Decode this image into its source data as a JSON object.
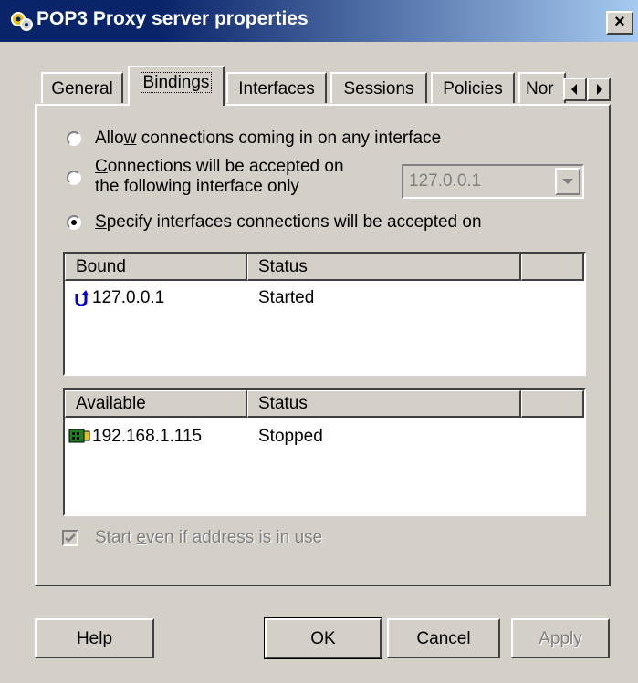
{
  "window": {
    "title": "POP3 Proxy server properties",
    "close_label": "×"
  },
  "tabs": [
    {
      "label": "General",
      "active": false
    },
    {
      "label": "Bindings",
      "active": true
    },
    {
      "label": "Interfaces",
      "active": false
    },
    {
      "label": "Sessions",
      "active": false
    },
    {
      "label": "Policies",
      "active": false
    },
    {
      "label": "Nor",
      "active": false
    }
  ],
  "radios": {
    "any_interface": {
      "pre": "Allo",
      "key": "w",
      "post": " connections coming in on any interface",
      "selected": false
    },
    "single_interface": {
      "line1_key": "C",
      "line1_post": "onnections will be accepted on",
      "line2": "the following interface only",
      "selected": false
    },
    "specify": {
      "key": "S",
      "post": "pecify interfaces connections will be accepted on",
      "selected": true
    }
  },
  "interface_select": {
    "value": "127.0.0.1"
  },
  "bound_list": {
    "headers": [
      "Bound",
      "Status"
    ],
    "rows": [
      {
        "address": "127.0.0.1",
        "status": "Started",
        "icon": "bound-arrow-icon"
      }
    ]
  },
  "available_list": {
    "headers": [
      "Available",
      "Status"
    ],
    "rows": [
      {
        "address": "192.168.1.115",
        "status": "Stopped",
        "icon": "network-card-icon"
      }
    ]
  },
  "start_in_use": {
    "pre": "Start ",
    "key": "e",
    "post": "ven if address is in use",
    "checked": true,
    "disabled": true
  },
  "buttons": {
    "help": "Help",
    "ok": "OK",
    "cancel": "Cancel",
    "apply": "Apply"
  }
}
